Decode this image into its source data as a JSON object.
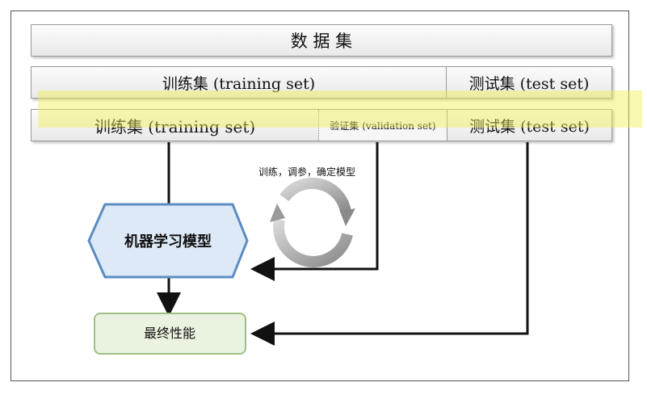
{
  "dataset": {
    "label": "数 据 集"
  },
  "split1": {
    "train": "训练集 (training set)",
    "test": "测试集 (test set)"
  },
  "split2": {
    "train": "训练集 (training set)",
    "validation": "验证集 (validation set)",
    "test": "测试集 (test set)"
  },
  "loop_label": "训练，调参，确定模型",
  "model_label": "机器学习模型",
  "performance_label": "最终性能",
  "colors": {
    "highlight": "#f0f050",
    "model_fill": "#dde9f7",
    "model_stroke": "#5b8cc0",
    "perf_fill": "#eaf3df",
    "perf_stroke": "#9fbf86"
  }
}
